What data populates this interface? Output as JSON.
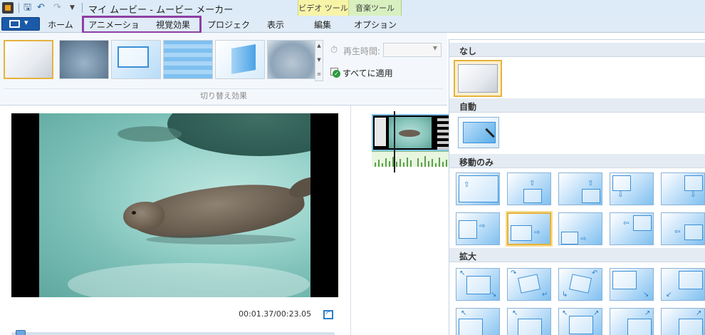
{
  "window": {
    "title": "マイ ムービー - ムービー メーカー",
    "context_tabs": {
      "video_tools": "ビデオ ツール",
      "music_tools": "音楽ツール"
    }
  },
  "quick_access": {
    "save_icon": "save-icon",
    "undo_icon": "undo-icon",
    "redo_icon": "redo-icon",
    "customize_icon": "dropdown-arrow-icon"
  },
  "tabs": [
    {
      "label": "ホーム"
    },
    {
      "label": "アニメーション"
    },
    {
      "label": "視覚効果"
    },
    {
      "label": "プロジェクト"
    },
    {
      "label": "表示"
    },
    {
      "label": "編集"
    },
    {
      "label": "オプション"
    }
  ],
  "ribbon": {
    "transitions": {
      "group_label": "切り替え効果",
      "duration_label": "再生時間:",
      "duration_value": "",
      "apply_all_label": "すべてに適用"
    }
  },
  "preview": {
    "time": "00:01.37/00:23.05"
  },
  "effects_panel": {
    "sections": [
      {
        "label": "なし"
      },
      {
        "label": "自動"
      },
      {
        "label": "移動のみ"
      },
      {
        "label": "拡大"
      }
    ]
  },
  "colors": {
    "tab_highlight": "#8d3fa4",
    "selected_border": "#e6b23d",
    "accent_blue": "#1a5aa8"
  }
}
